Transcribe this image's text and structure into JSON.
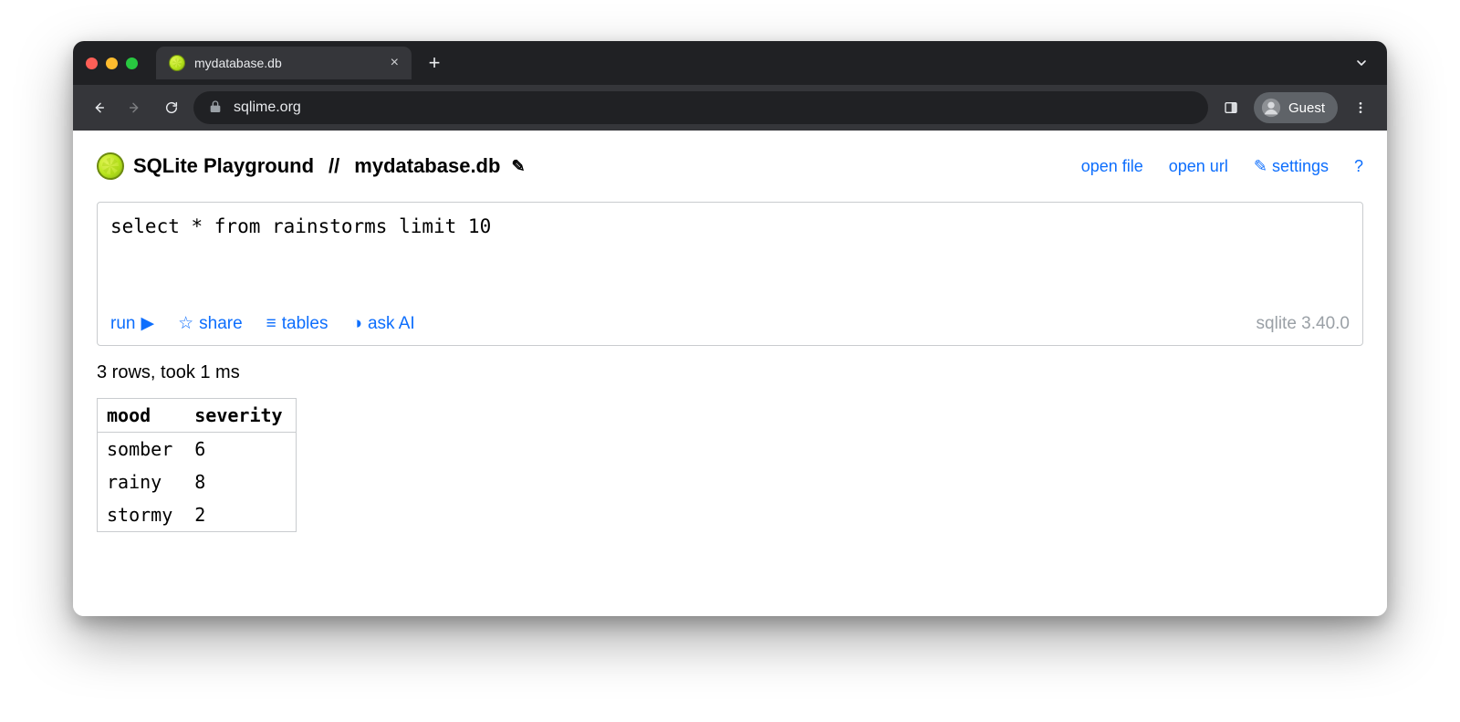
{
  "browser": {
    "tab_title": "mydatabase.db",
    "url": "sqlime.org",
    "guest_label": "Guest"
  },
  "header": {
    "app_name": "SQLite Playground",
    "separator": "//",
    "db_name": "mydatabase.db",
    "links": {
      "open_file": "open file",
      "open_url": "open url",
      "settings": "settings",
      "help": "?"
    }
  },
  "editor": {
    "sql": "select * from rainstorms limit 10",
    "actions": {
      "run": "run",
      "share": "share",
      "tables": "tables",
      "ask_ai": "ask AI"
    },
    "version": "sqlite 3.40.0"
  },
  "results": {
    "status": "3 rows, took 1 ms",
    "columns": [
      "mood",
      "severity"
    ],
    "rows": [
      [
        "somber",
        "6"
      ],
      [
        "rainy",
        "8"
      ],
      [
        "stormy",
        "2"
      ]
    ]
  }
}
